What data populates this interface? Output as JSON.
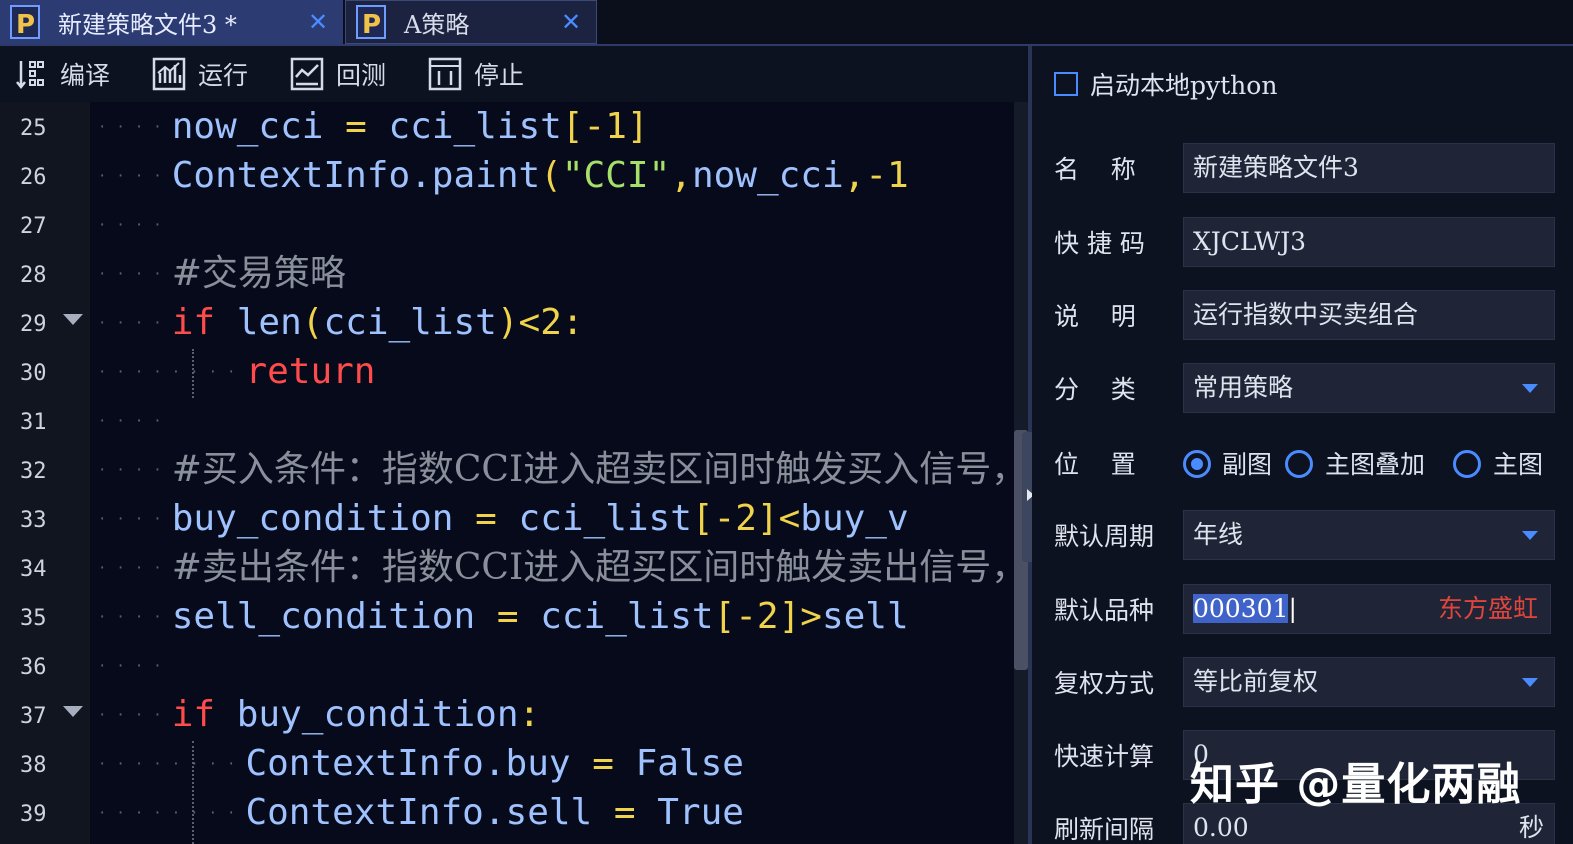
{
  "tabs": [
    {
      "label": "新建策略文件3 *",
      "close": "✕"
    },
    {
      "label": "A策略",
      "close": "✕"
    }
  ],
  "toolbar": {
    "compile": "编译",
    "run": "运行",
    "backtest": "回测",
    "stop": "停止"
  },
  "editor": {
    "line_numbers": [
      "25",
      "26",
      "27",
      "28",
      "29",
      "30",
      "31",
      "32",
      "33",
      "34",
      "35",
      "36",
      "37",
      "38",
      "39"
    ],
    "lines": {
      "l25": {
        "a": "now_cci",
        "b": " = ",
        "c": "cci_list",
        "d": "[-1]"
      },
      "l26": {
        "a": "ContextInfo.paint",
        "b": "(",
        "c": "\"CCI\"",
        "d": ",",
        "e": "now_cci",
        "f": ",-1"
      },
      "l28": {
        "a": "#交易策略"
      },
      "l29": {
        "a": "if",
        "b": " len",
        "c": "(",
        "d": "cci_list",
        "e": ")<2:"
      },
      "l30": {
        "a": "return"
      },
      "l32": {
        "a": "#买入条件：指数CCI进入超卖区间时触发买入信号，"
      },
      "l33": {
        "a": "buy_condition",
        "b": " = ",
        "c": "cci_list",
        "d": "[-2]<",
        "e": "buy_v"
      },
      "l34": {
        "a": "#卖出条件：指数CCI进入超买区间时触发卖出信号，"
      },
      "l35": {
        "a": "sell_condition",
        "b": " = ",
        "c": "cci_list",
        "d": "[-2]>",
        "e": "sell"
      },
      "l37": {
        "a": "if",
        "b": " buy_condition",
        "c": ":"
      },
      "l38": {
        "a": "ContextInfo.buy",
        "b": " = ",
        "c": "False"
      },
      "l39": {
        "a": "ContextInfo.sell",
        "b": " = ",
        "c": "True"
      }
    }
  },
  "panel": {
    "local_python_label": "启动本地python",
    "name_label": "名    称",
    "name_value": "新建策略文件3",
    "shortcut_label": "快 捷 码",
    "shortcut_value": "XJCLWJ3",
    "desc_label": "说    明",
    "desc_value": "运行指数中买卖组合",
    "category_label": "分    类",
    "category_value": "常用策略",
    "position_label": "位    置",
    "position_options": [
      "副图",
      "主图叠加",
      "主图"
    ],
    "period_label": "默认周期",
    "period_value": "年线",
    "symbol_label": "默认品种",
    "symbol_code": "000301",
    "symbol_name": "东方盛虹",
    "adjust_label": "复权方式",
    "adjust_value": "等比前复权",
    "quick_calc_label": "快速计算",
    "quick_calc_value": "0",
    "refresh_label": "刷新间隔",
    "refresh_value": "0.00",
    "refresh_unit": "秒"
  },
  "watermark": "知乎 @量化两融",
  "colors": {
    "accent": "#4a8cff",
    "keyword": "#ff4b4b",
    "string": "#a6e06a",
    "operator": "#f0d34a",
    "identifier": "#9fc2ff",
    "comment": "#8a8f9c",
    "stock_name": "#e0453d"
  }
}
